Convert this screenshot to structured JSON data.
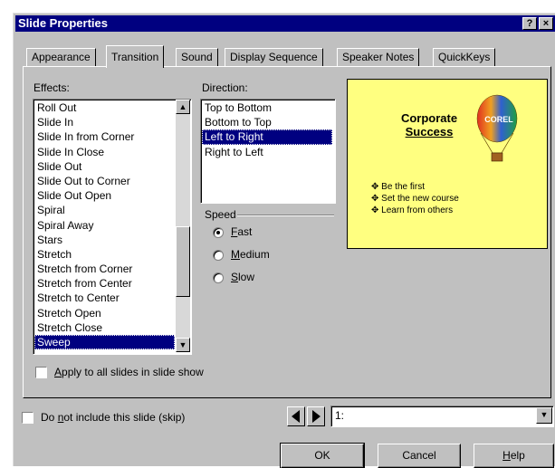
{
  "window": {
    "title": "Slide Properties",
    "help_label": "?",
    "close_label": "×"
  },
  "tabs": [
    {
      "label": "Appearance",
      "active": false
    },
    {
      "label": "Transition",
      "active": true
    },
    {
      "label": "Sound",
      "active": false
    },
    {
      "label": "Display Sequence",
      "active": false
    },
    {
      "label": "Speaker Notes",
      "active": false
    },
    {
      "label": "QuickKeys",
      "active": false
    }
  ],
  "effects": {
    "label": "Effects:",
    "items": [
      "Roll Out",
      "Slide In",
      "Slide In from Corner",
      "Slide In Close",
      "Slide Out",
      "Slide Out to Corner",
      "Slide Out Open",
      "Spiral",
      "Spiral Away",
      "Stars",
      "Stretch",
      "Stretch from Corner",
      "Stretch from Center",
      "Stretch to Center",
      "Stretch Open",
      "Stretch Close",
      "Sweep"
    ],
    "selected": "Sweep"
  },
  "direction": {
    "label": "Direction:",
    "items": [
      "Top to Bottom",
      "Bottom to Top",
      "Left to Right",
      "Right to Left"
    ],
    "selected": "Left to Right"
  },
  "speed": {
    "label": "Speed",
    "options": [
      {
        "label": "Fast",
        "checked": true
      },
      {
        "label": "Medium",
        "checked": false
      },
      {
        "label": "Slow",
        "checked": false
      }
    ]
  },
  "preview": {
    "title_line1": "Corporate",
    "title_line2": "Success",
    "balloon_text": "COREL",
    "bullets": [
      "Be the first",
      "Set the new course",
      "Learn from others"
    ]
  },
  "apply_all": {
    "label": "Apply to all slides in slide show",
    "checked": false
  },
  "skip": {
    "label": "Do not include this slide (skip)",
    "checked": false
  },
  "slide_select": {
    "value": "1:"
  },
  "buttons": {
    "ok": "OK",
    "cancel": "Cancel",
    "help": "Help"
  },
  "colors": {
    "titlebar": "#000080",
    "dialog": "#c0c0c0",
    "preview_bg": "#ffff80",
    "selection": "#000080"
  }
}
